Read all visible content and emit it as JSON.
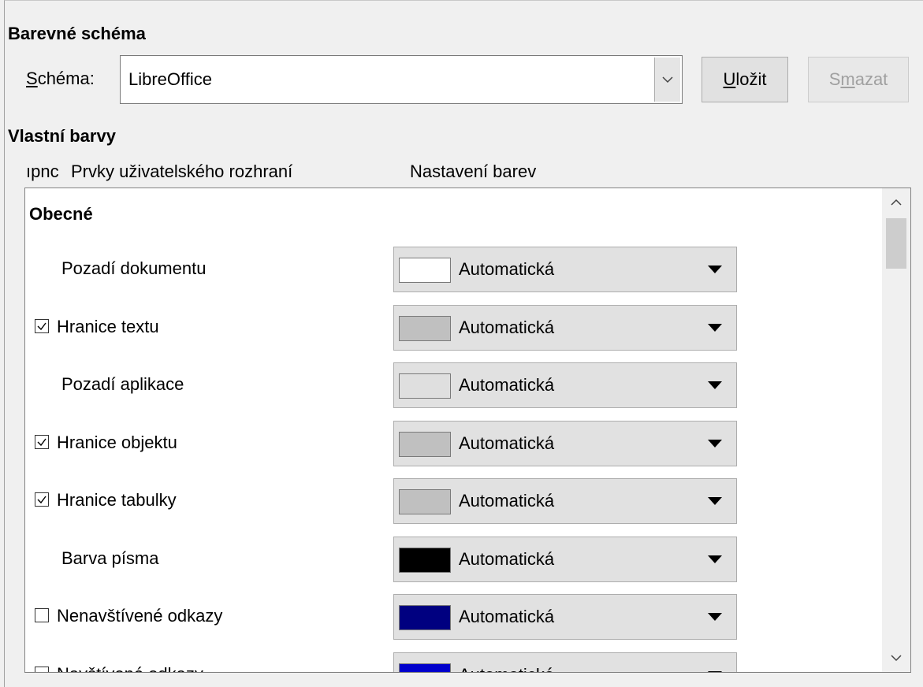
{
  "color_scheme": {
    "section_title": "Barevné schéma",
    "scheme_label_first": "S",
    "scheme_label_rest": "chéma:",
    "scheme_value": "LibreOffice",
    "save_button": {
      "ul": "U",
      "rest": "ložit"
    },
    "delete_button": {
      "pre": "S",
      "ul": "m",
      "rest": "azat"
    }
  },
  "custom_colors": {
    "section_title": "Vlastní barvy",
    "columns": {
      "on_truncated": "ıpnc",
      "ui_elements": "Prvky uživatelského rozhraní",
      "color_setting": "Nastavení barev"
    },
    "group_title": "Obecné",
    "rows": [
      {
        "name": "Pozadí dokumentu",
        "has_checkbox": false,
        "checked": false,
        "value": "Automatická",
        "swatch": "#ffffff"
      },
      {
        "name": "Hranice textu",
        "has_checkbox": true,
        "checked": true,
        "value": "Automatická",
        "swatch": "#c0c0c0"
      },
      {
        "name": "Pozadí aplikace",
        "has_checkbox": false,
        "checked": false,
        "value": "Automatická",
        "swatch": "#dfdfdf"
      },
      {
        "name": "Hranice objektu",
        "has_checkbox": true,
        "checked": true,
        "value": "Automatická",
        "swatch": "#c0c0c0"
      },
      {
        "name": "Hranice tabulky",
        "has_checkbox": true,
        "checked": true,
        "value": "Automatická",
        "swatch": "#c0c0c0"
      },
      {
        "name": "Barva písma",
        "has_checkbox": false,
        "checked": false,
        "value": "Automatická",
        "swatch": "#000000"
      },
      {
        "name": "Nenavštívené odkazy",
        "has_checkbox": true,
        "checked": false,
        "value": "Automatická",
        "swatch": "#000080"
      },
      {
        "name": "Navštívené odkazy",
        "has_checkbox": true,
        "checked": false,
        "value": "Automatická",
        "swatch": "#0000cc"
      }
    ]
  }
}
